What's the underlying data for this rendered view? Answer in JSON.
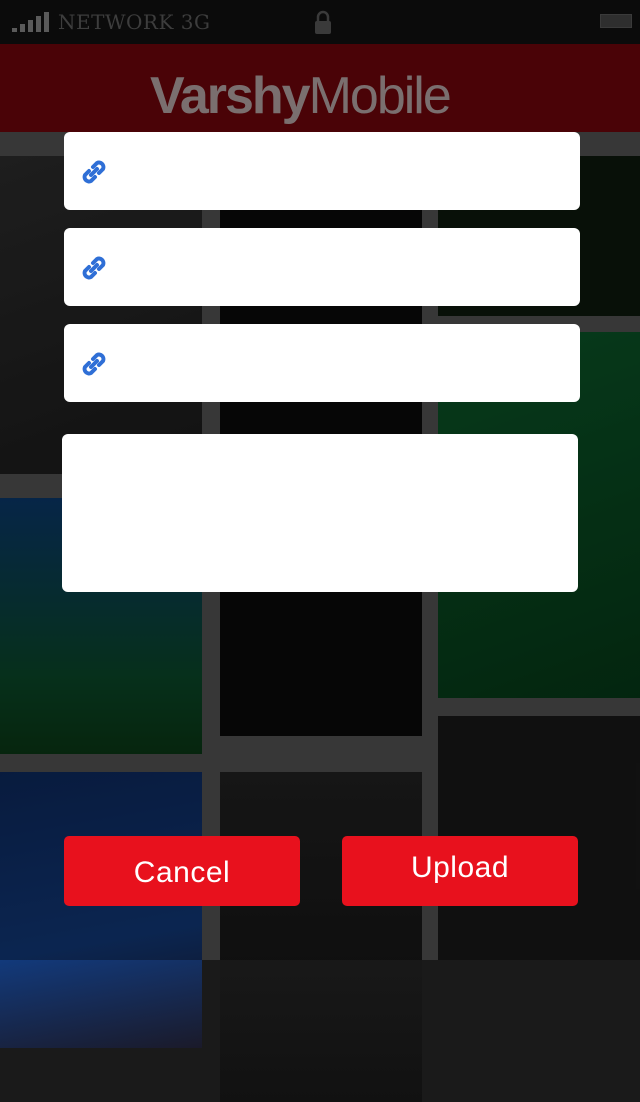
{
  "status_bar": {
    "carrier": "NETWORK 3G",
    "icons": {
      "signal": "signal-bars-icon",
      "lock": "lock-icon",
      "battery": "battery-icon"
    }
  },
  "header": {
    "logo_bold": "Varshy",
    "logo_light": "Mobile"
  },
  "form": {
    "link_fields": [
      {
        "icon": "link-icon",
        "value": "",
        "placeholder": ""
      },
      {
        "icon": "link-icon",
        "value": "",
        "placeholder": ""
      },
      {
        "icon": "link-icon",
        "value": "",
        "placeholder": ""
      }
    ],
    "description": {
      "value": "",
      "placeholder": ""
    }
  },
  "actions": {
    "cancel_label": "Cancel",
    "upload_label": "Upload"
  },
  "colors": {
    "button_red": "#e8111d",
    "header_maroon": "#4a0307",
    "link_icon_blue": "#2f6fd6"
  }
}
